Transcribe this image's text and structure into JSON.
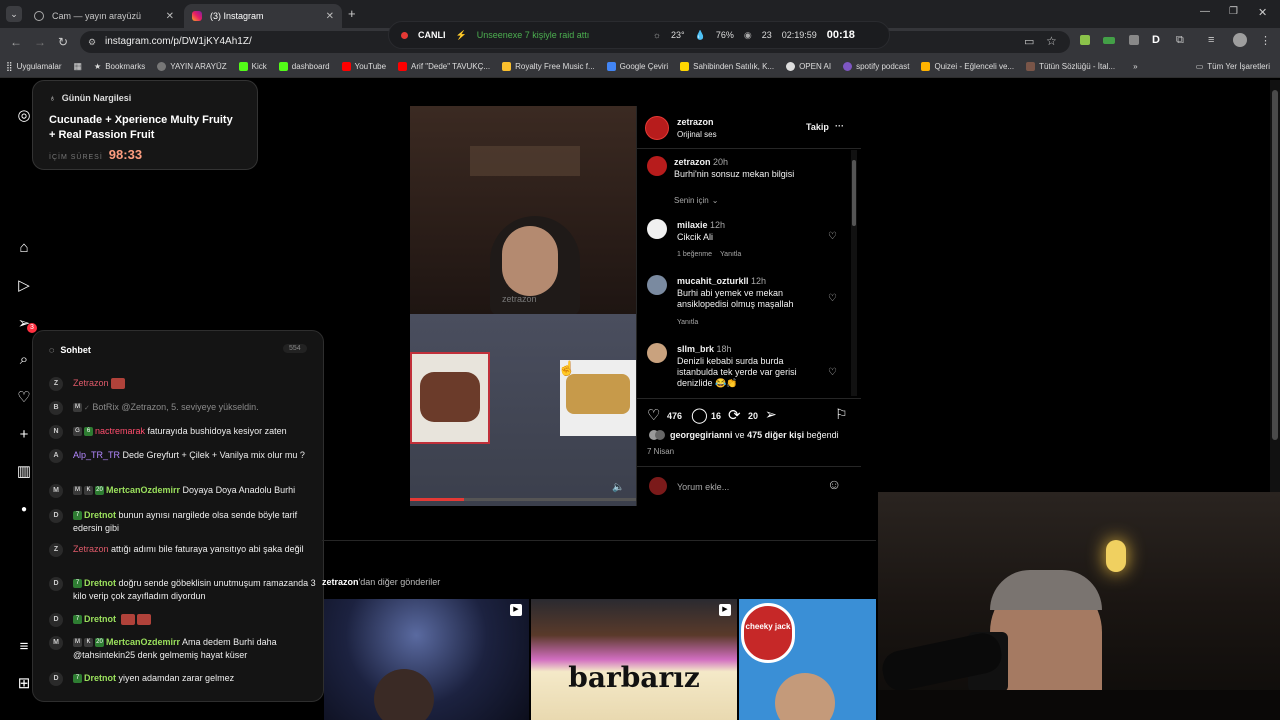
{
  "browser": {
    "tabs": [
      {
        "label": "Cam — yayın arayüzü"
      },
      {
        "label": "(3) Instagram"
      }
    ],
    "url": "instagram.com/p/DW1jKY4Ah1Z/"
  },
  "stream_status": {
    "live": "CANLI",
    "raid": "Unseenexe 7 kişiyle raid attı",
    "temp": "23°",
    "humidity": "76%",
    "viewers": "23",
    "uptime": "02:19:59",
    "timer": "00:18"
  },
  "bookmarks": [
    "Uygulamalar",
    "Bookmarks",
    "YAYIN ARAYÜZ",
    "Kick",
    "dashboard",
    "YouTube",
    "Arif \"Dede\" TAVUKÇ...",
    "Royalty Free Music f...",
    "Google Çeviri",
    "Sahibinden Satılık, K...",
    "OPEN AI",
    "spotify podcast",
    "Quizei - Eğlenceli ve...",
    "Tütün Sözlüğü - İtal...",
    "Tüm Yer İşaretleri"
  ],
  "nargile": {
    "header": "Günün Nargilesi",
    "title": "Cucunade + Xperience Multy Fruity + Real Passion Fruit",
    "time_label": "İÇİM SÜRESİ",
    "time": "98:33"
  },
  "rail": {
    "notif_count": "3"
  },
  "chat": {
    "title": "Sohbet",
    "count": "554",
    "messages": [
      {
        "initial": "Z",
        "user": "Zetrazon",
        "text": ""
      },
      {
        "initial": "B",
        "user": "BotRix",
        "text": "@Zetrazon, 5. seviyeye yükseldin."
      },
      {
        "initial": "N",
        "user": "nactremarak",
        "text": "faturayıda bushidoya kesiyor zaten"
      },
      {
        "initial": "A",
        "user": "Alp_TR_TR",
        "text": "Dede Greyfurt + Çilek + Vanilya mix olur mu ?"
      },
      {
        "initial": "M",
        "user": "MertcanOzdemirr",
        "text": "Doyaya Doya Anadolu Burhi"
      },
      {
        "initial": "D",
        "user": "Dretnot",
        "text": "bunun aynısı nargilede olsa sende böyle tarif edersin gibi"
      },
      {
        "initial": "Z",
        "user": "Zetrazon",
        "text": "attığı adımı bile faturaya yansıtıyo abi şaka değil"
      },
      {
        "initial": "D",
        "user": "Dretnot",
        "text": "doğru sende göbeklisin unutmuşum ramazanda 3 kilo verip çok zayıfladım diyordun"
      },
      {
        "initial": "D",
        "user": "Dretnot",
        "text": ""
      },
      {
        "initial": "M",
        "user": "MertcanOzdemirr",
        "text": "Ama dedem Burhi daha @tahsintekin25 denk gelmemiş hayat küser"
      },
      {
        "initial": "D",
        "user": "Dretnot",
        "text": "yiyen adamdan zarar gelmez"
      }
    ],
    "badges": {
      "g": "G",
      "six": "6",
      "m": "M",
      "k": "K",
      "twenty": "20",
      "seven": "7"
    }
  },
  "post": {
    "author": "zetrazon",
    "audio": "Orijinal ses",
    "follow": "Takip",
    "more": "···",
    "caption_time": "20h",
    "caption": "Burhi'nin sonsuz mekan bilgisi",
    "for_you": "Senin için",
    "comments": [
      {
        "user": "milaxie",
        "time": "12h",
        "text": "Cikcik Ali",
        "likes": "1 beğenme",
        "reply": "Yanıtla"
      },
      {
        "user": "mucahit_ozturkll",
        "time": "12h",
        "text": "Burhi abi yemek ve mekan ansiklopedisi olmuş maşallah",
        "reply": "Yanıtla"
      },
      {
        "user": "sllm_brk",
        "time": "18h",
        "text": "Denizli kebabi surda burda istanbulda tek yerde var gerisi denizlide 😂👏"
      }
    ],
    "likes": "476",
    "comment_count": "16",
    "reposts": "20",
    "liked_by_user": "georgegirianni",
    "liked_by_rest": "ve",
    "liked_by_count": "475 diğer kişi",
    "liked_by_suffix": "beğendi",
    "date": "7 Nisan",
    "comment_placeholder": "Yorum ekle...",
    "video_watermark": "zetrazon"
  },
  "more_posts": {
    "user": "zetrazon",
    "suffix": "'dan diğer gönderiler",
    "thumb2_text": "barbarız",
    "thumb3_text": "cheeky jack"
  }
}
